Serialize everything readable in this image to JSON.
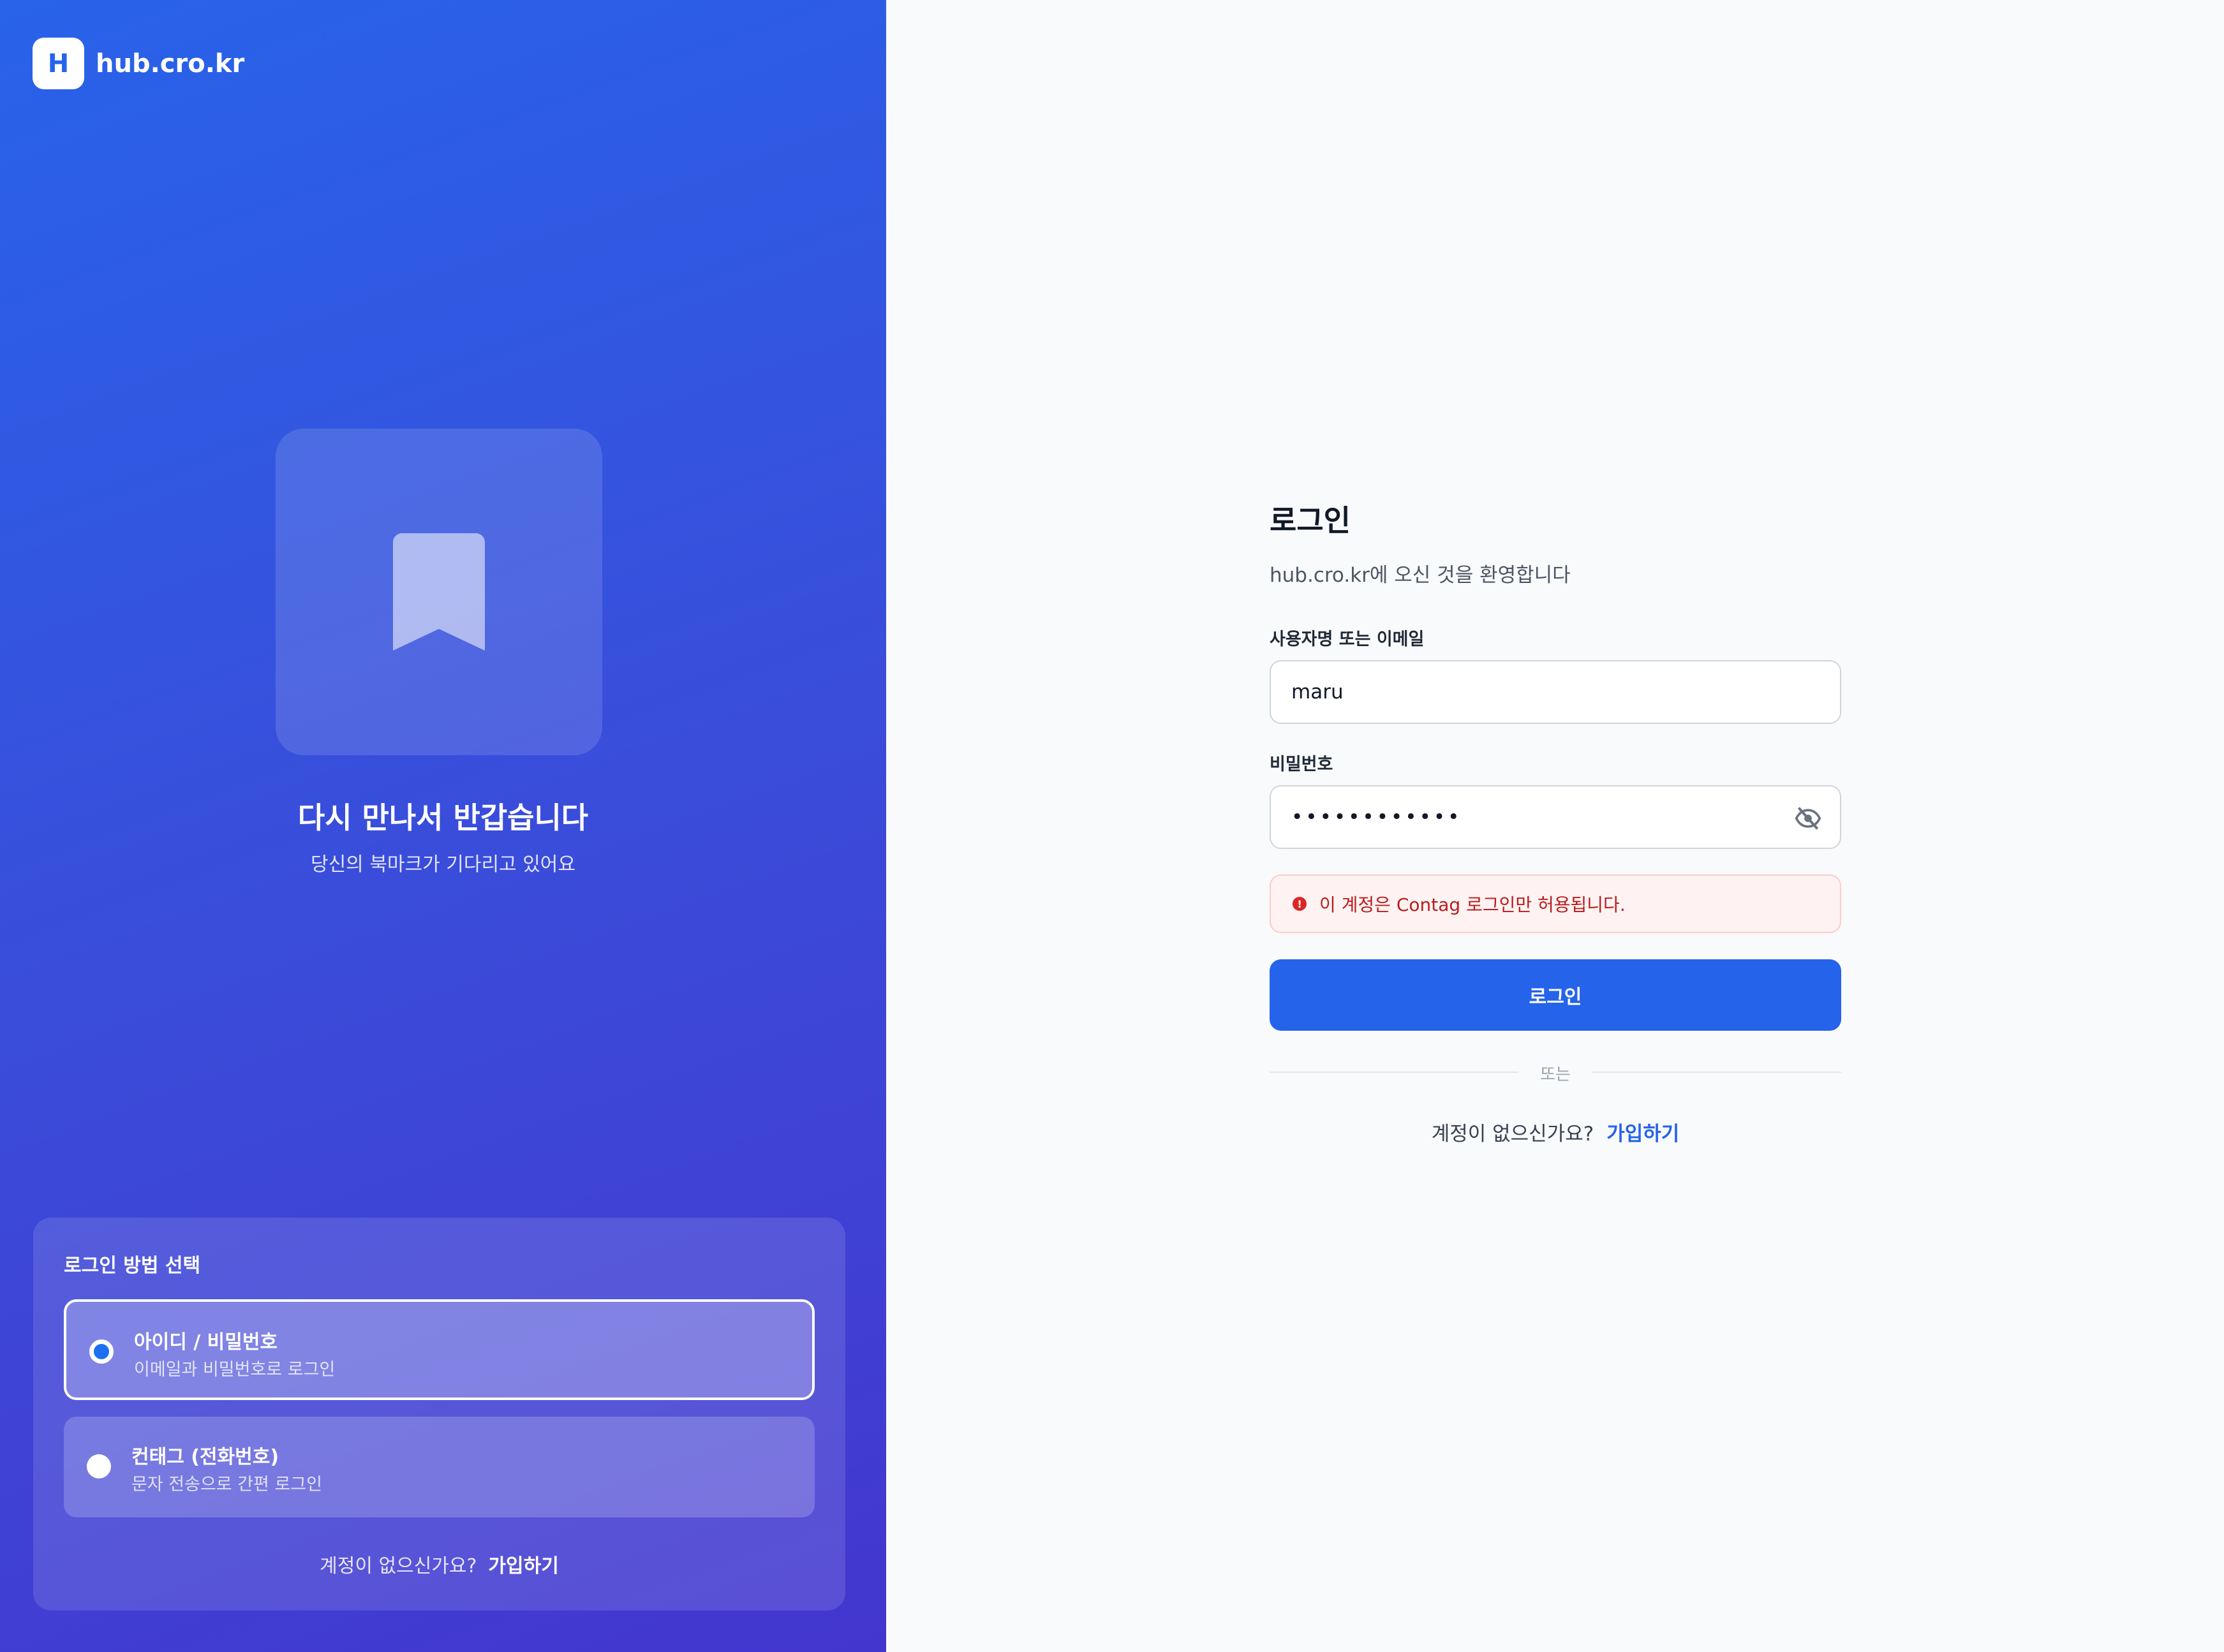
{
  "brand": {
    "logo_letter": "H",
    "name": "hub.cro.kr"
  },
  "hero": {
    "icon": "bookmark-icon",
    "title": "다시 만나서 반갑습니다",
    "subtitle": "당신의 북마크가 기다리고 있어요"
  },
  "method": {
    "title": "로그인 방법 선택",
    "options": [
      {
        "title": "아이디 / 비밀번호",
        "desc": "이메일과 비밀번호로 로그인",
        "selected": true
      },
      {
        "title": "컨태그 (전화번호)",
        "desc": "문자 전송으로 간편 로그인",
        "selected": false
      }
    ],
    "footer_text": "계정이 없으신가요?",
    "footer_link": "가입하기"
  },
  "form": {
    "title": "로그인",
    "subtitle": "hub.cro.kr에 오신 것을 환영합니다",
    "username_label": "사용자명 또는 이메일",
    "username_value": "maru",
    "password_label": "비밀번호",
    "password_value": "••••••••••••",
    "error_message": "이 계정은 Contag 로그인만 허용됩니다.",
    "submit_label": "로그인",
    "divider_text": "또는",
    "signup_text": "계정이 없으신가요?",
    "signup_link": "가입하기"
  },
  "colors": {
    "accent": "#2563eb",
    "error": "#dc2626",
    "gradient_start": "#2863e9",
    "gradient_end": "#4336cf"
  }
}
